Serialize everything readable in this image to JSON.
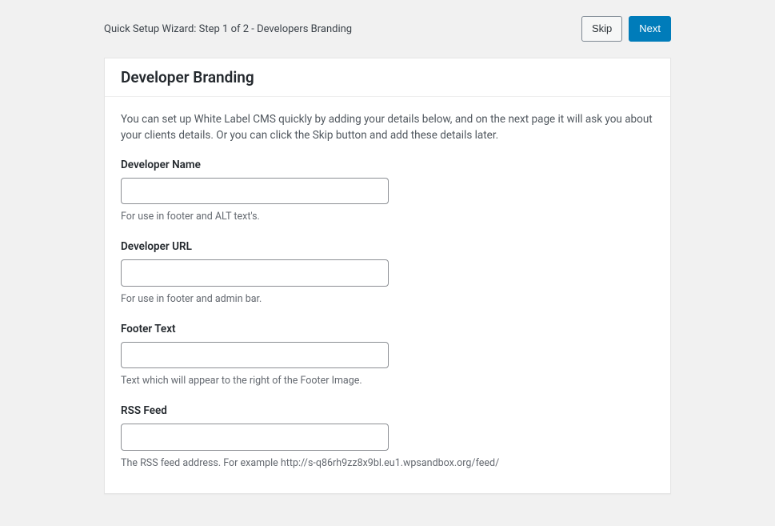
{
  "header": {
    "title": "Quick Setup Wizard: Step 1 of 2 - Developers Branding",
    "skip_label": "Skip",
    "next_label": "Next"
  },
  "panel": {
    "heading": "Developer Branding",
    "intro": "You can set up White Label CMS quickly by adding your details below, and on the next page it will ask you about your clients details. Or you can click the Skip button and add these details later."
  },
  "fields": {
    "developer_name": {
      "label": "Developer Name",
      "value": "",
      "help": "For use in footer and ALT text's."
    },
    "developer_url": {
      "label": "Developer URL",
      "value": "",
      "help": "For use in footer and admin bar."
    },
    "footer_text": {
      "label": "Footer Text",
      "value": "",
      "help": "Text which will appear to the right of the Footer Image."
    },
    "rss_feed": {
      "label": "RSS Feed",
      "value": "",
      "help": "The RSS feed address. For example http://s-q86rh9zz8x9bl.eu1.wpsandbox.org/feed/"
    }
  }
}
